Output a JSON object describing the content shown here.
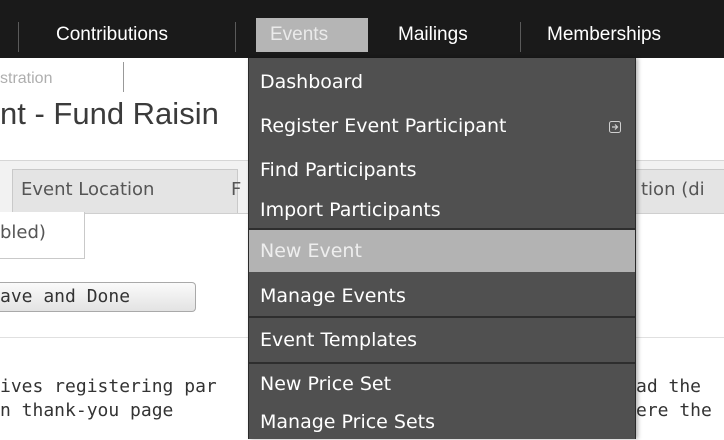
{
  "nav": {
    "items": [
      "Contributions",
      "Events",
      "Mailings",
      "Memberships"
    ]
  },
  "page": {
    "ghost_breadcrumb": "stration",
    "title": "nt - Fund Raisin",
    "tab_location": "Event Location",
    "tab_location_trailing": "F",
    "tab_right": "tion (di",
    "tab_enabled": "bled)",
    "save_done": "ave and Done",
    "desc_left_1": "ives registering par",
    "desc_left_2": "n thank-you page",
    "desc_right_1": "ad the",
    "desc_right_2": "ere the"
  },
  "dropdown": {
    "items": [
      {
        "label": "Dashboard"
      },
      {
        "label": "Register Event Participant",
        "submenu_icon": "arrow-right-icon"
      },
      {
        "label": "Find Participants"
      },
      {
        "label": "Import Participants"
      },
      {
        "label": "New Event",
        "highlighted": true
      },
      {
        "label": "Manage Events"
      },
      {
        "label": "Event Templates"
      },
      {
        "label": "New Price Set"
      },
      {
        "label": "Manage Price Sets"
      }
    ]
  },
  "colors": {
    "nav_bg": "#1a1a1a",
    "menu_bg": "#505050",
    "highlight": "#b3b3b3"
  }
}
